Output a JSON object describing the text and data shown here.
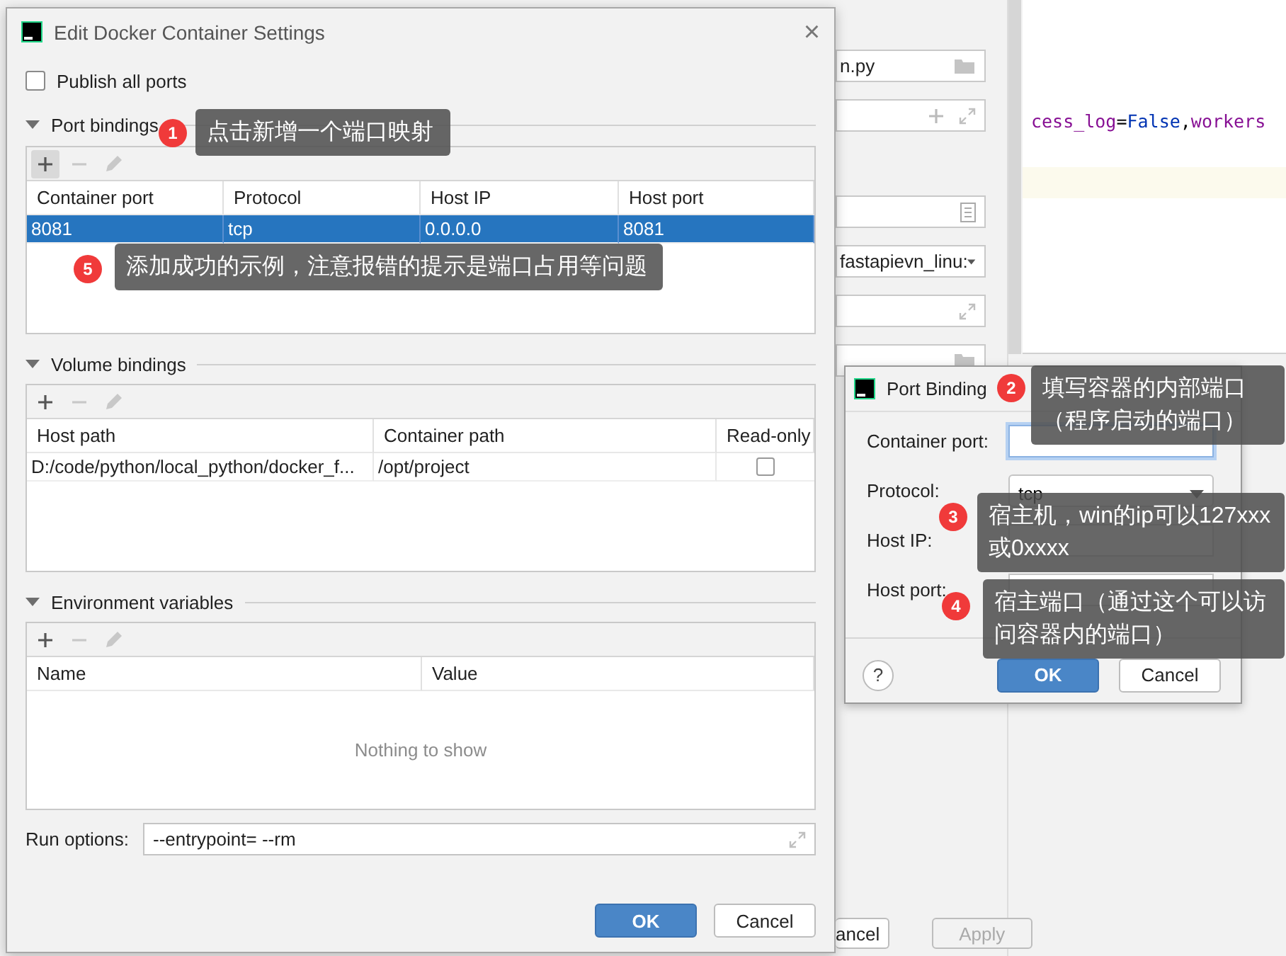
{
  "background_window": {
    "fields": [
      {
        "kind": "folder",
        "value": "n.py"
      },
      {
        "kind": "add-expand"
      },
      {
        "kind": "document"
      },
      {
        "kind": "dropdown",
        "value": "fastapievn_linu:"
      },
      {
        "kind": "expand"
      },
      {
        "kind": "folder"
      }
    ],
    "buttons": [
      {
        "label": "ancel",
        "disabled": false
      },
      {
        "label": "Apply",
        "disabled": true
      }
    ]
  },
  "editor": {
    "code_tokens": [
      {
        "text": "cess_log",
        "kind": "param"
      },
      {
        "text": "=",
        "kind": "plain"
      },
      {
        "text": "False",
        "kind": "keyword"
      },
      {
        "text": ",",
        "kind": "plain"
      },
      {
        "text": "workers",
        "kind": "param"
      }
    ]
  },
  "main_dialog": {
    "title": "Edit Docker Container Settings",
    "close": "×",
    "publish_all_ports": {
      "label": "Publish all ports",
      "checked": false
    },
    "sections": [
      {
        "title": "Port bindings",
        "expanded": true,
        "add_hovered": true,
        "columns": [
          "Container port",
          "Protocol",
          "Host IP",
          "Host port"
        ],
        "rows": [
          {
            "cells": [
              "8081",
              "tcp",
              "0.0.0.0",
              "8081"
            ],
            "selected": true
          }
        ]
      },
      {
        "title": "Volume bindings",
        "expanded": true,
        "add_hovered": false,
        "columns": [
          "Host path",
          "Container path",
          "Read-only"
        ],
        "rows": [
          {
            "cells": [
              "D:/code/python/local_python/docker_f...",
              "/opt/project"
            ],
            "read_only": false,
            "selected": false
          }
        ]
      },
      {
        "title": "Environment variables",
        "expanded": true,
        "add_hovered": false,
        "columns": [
          "Name",
          "Value"
        ],
        "empty_text": "Nothing to show"
      }
    ],
    "run_options": {
      "label": "Run options:",
      "value": "--entrypoint= --rm"
    },
    "buttons": [
      {
        "label": "OK",
        "primary": true
      },
      {
        "label": "Cancel",
        "primary": false
      }
    ]
  },
  "port_dialog": {
    "title": "Port Binding",
    "fields": [
      {
        "label": "Container port:",
        "kind": "text",
        "focused": true
      },
      {
        "label": "Protocol:",
        "kind": "select",
        "value": "tcp"
      },
      {
        "label": "Host IP:",
        "kind": "text"
      },
      {
        "label": "Host port:",
        "kind": "text",
        "focused": false
      }
    ],
    "help": "?",
    "buttons": [
      {
        "label": "OK",
        "primary": true
      },
      {
        "label": "Cancel",
        "primary": false
      }
    ]
  },
  "annotations": [
    {
      "number": "1",
      "text": "点击新增一个端口映射"
    },
    {
      "number": "5",
      "text": "添加成功的示例，注意报错的提示是端口占用等问题"
    },
    {
      "number": "2",
      "text": "填写容器的内部端口（程序启动的端口）"
    },
    {
      "number": "3",
      "text": "宿主机，win的ip可以127xxx或0xxxx"
    },
    {
      "number": "4",
      "text": "宿主端口（通过这个可以访问容器内的端口）"
    }
  ]
}
